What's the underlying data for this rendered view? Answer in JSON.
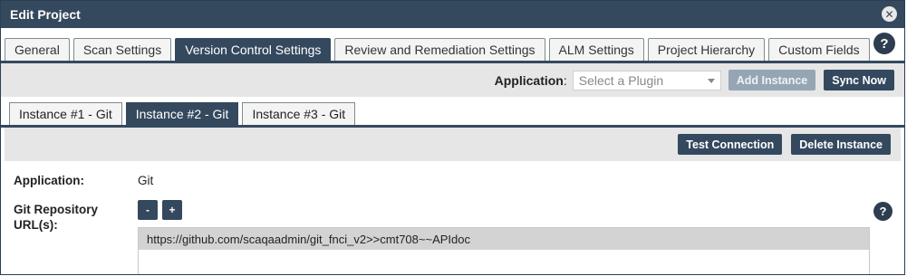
{
  "dialog": {
    "title": "Edit Project",
    "close_glyph": "✕",
    "help_glyph": "?"
  },
  "tabs": [
    {
      "label": "General"
    },
    {
      "label": "Scan Settings"
    },
    {
      "label": "Version Control Settings",
      "active": true
    },
    {
      "label": "Review and Remediation Settings"
    },
    {
      "label": "ALM Settings"
    },
    {
      "label": "Project Hierarchy"
    },
    {
      "label": "Custom Fields"
    }
  ],
  "application_bar": {
    "label": "Application",
    "colon": ":",
    "select_placeholder": "Select a Plugin",
    "add_instance_label": "Add Instance",
    "sync_now_label": "Sync Now"
  },
  "instance_tabs": [
    {
      "label": "Instance #1 - Git"
    },
    {
      "label": "Instance #2 - Git",
      "active": true
    },
    {
      "label": "Instance #3 - Git"
    }
  ],
  "actions": {
    "test_connection_label": "Test Connection",
    "delete_instance_label": "Delete Instance"
  },
  "form": {
    "application_label": "Application:",
    "application_value": "Git",
    "repo_label": "Git Repository URL(s):",
    "minus_label": "-",
    "plus_label": "+",
    "help_glyph": "?",
    "urls": [
      "https://github.com/scaqaadmin/git_fnci_v2>>cmt708~~APIdoc"
    ]
  },
  "colors": {
    "header": "#34495e",
    "bar_bg": "#e6e6e6",
    "disabled_button": "#95a5b3"
  }
}
